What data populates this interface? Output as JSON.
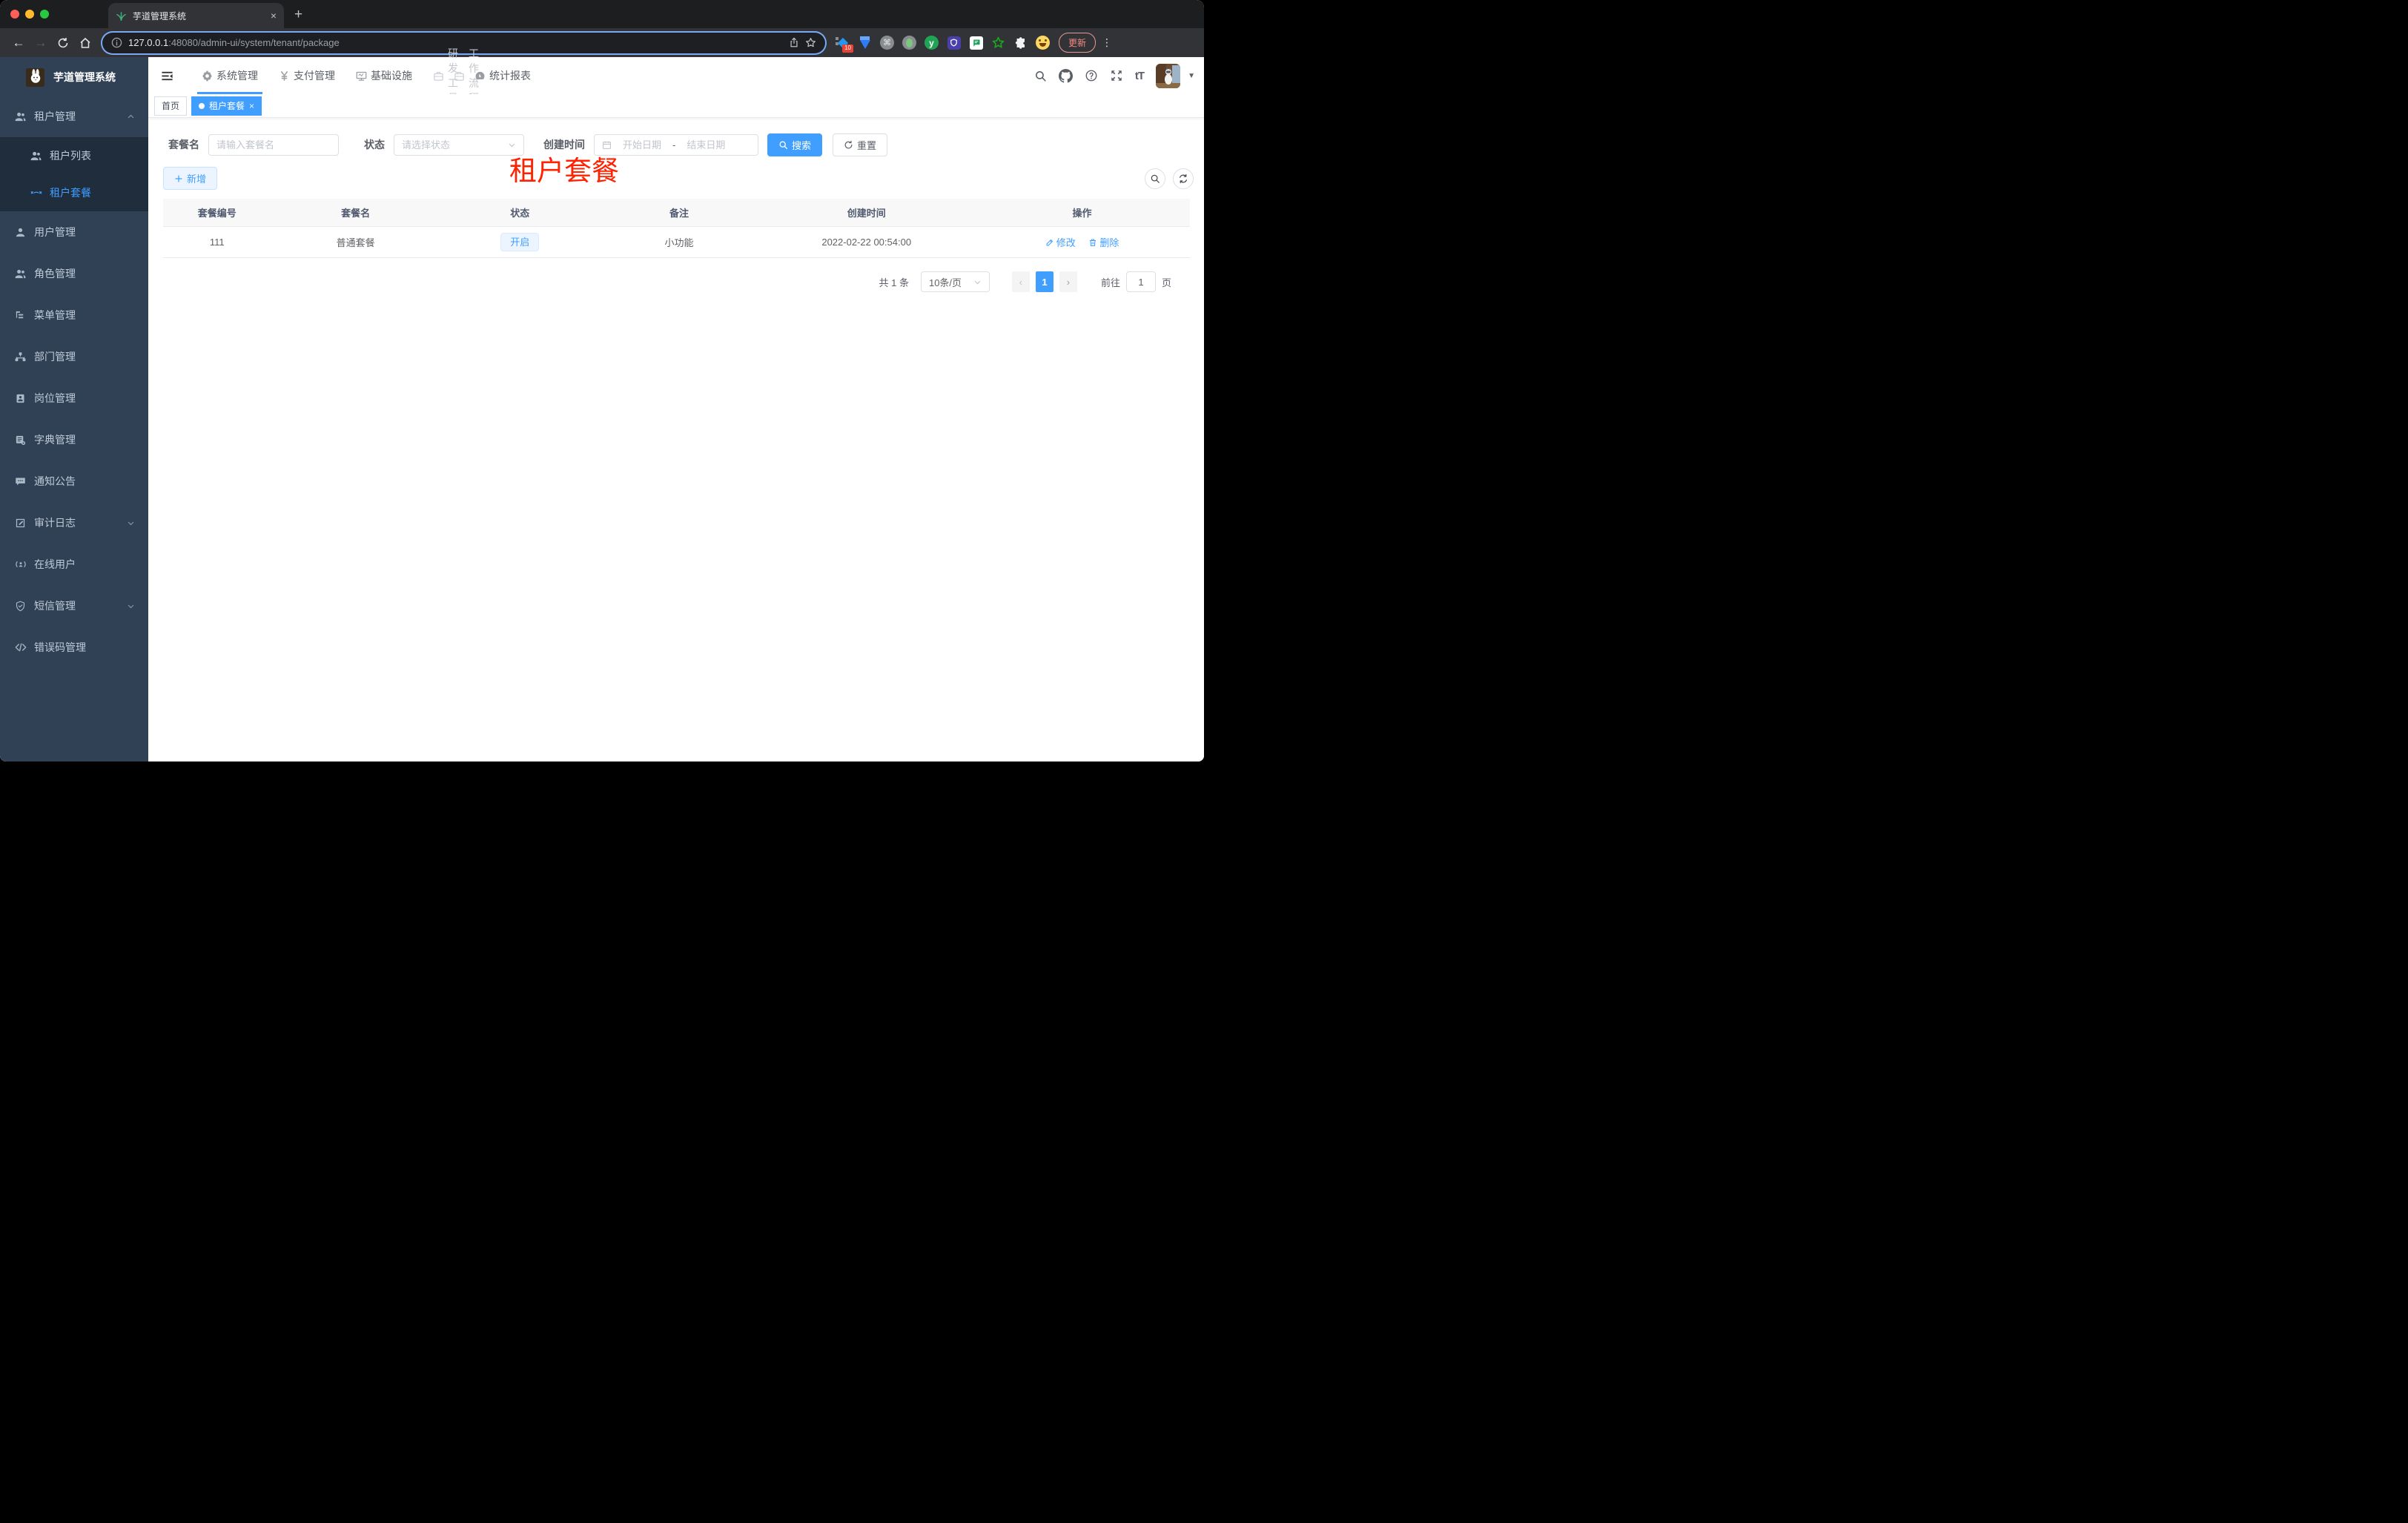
{
  "browser": {
    "tab_title": "芋道管理系统",
    "url_host": "127.0.0.1",
    "url_rest": ":48080/admin-ui/system/tenant/package",
    "extension_badge": "10",
    "update_label": "更新"
  },
  "glyphs": {
    "close": "×",
    "plus": "+",
    "back_arrow": "←",
    "forward_arrow": "→",
    "menu_dots": "⋮",
    "command": "⌘",
    "ext_y": "y",
    "font_size": "tT",
    "prev": "‹",
    "next": "›",
    "avatar_caret": "▼"
  },
  "sidebar": {
    "logo_title": "芋道管理系统",
    "tenant_group": "租户管理",
    "tenant_list": "租户列表",
    "tenant_package": "租户套餐",
    "items": {
      "user": "用户管理",
      "role": "角色管理",
      "menu": "菜单管理",
      "dept": "部门管理",
      "post": "岗位管理",
      "dict": "字典管理",
      "notice": "通知公告",
      "audit": "审计日志",
      "online": "在线用户",
      "sms": "短信管理",
      "errcode": "错误码管理"
    }
  },
  "topnav": {
    "system": "系统管理",
    "pay": "支付管理",
    "infra": "基础设施",
    "dev": "研发工具",
    "flow": "工作流程",
    "report": "统计报表"
  },
  "tags": {
    "home": "首页",
    "active": "租户套餐"
  },
  "overlay_title": "租户套餐",
  "filters": {
    "name_label": "套餐名",
    "name_placeholder": "请输入套餐名",
    "status_label": "状态",
    "status_placeholder": "请选择状态",
    "date_label": "创建时间",
    "date_start_placeholder": "开始日期",
    "date_separator": "-",
    "date_end_placeholder": "结束日期",
    "search_label": "搜索",
    "reset_label": "重置"
  },
  "toolbar": {
    "add_label": "新增"
  },
  "table": {
    "columns": [
      "套餐编号",
      "套餐名",
      "状态",
      "备注",
      "创建时间",
      "操作"
    ],
    "rows": [
      {
        "id": "111",
        "name": "普通套餐",
        "status": "开启",
        "remark": "小功能",
        "created": "2022-02-22 00:54:00",
        "edit_label": "修改",
        "delete_label": "删除"
      }
    ]
  },
  "pagination": {
    "total": "共 1 条",
    "page_size": "10条/页",
    "current": "1",
    "goto_label": "前往",
    "goto_value": "1",
    "unit_label": "页"
  }
}
